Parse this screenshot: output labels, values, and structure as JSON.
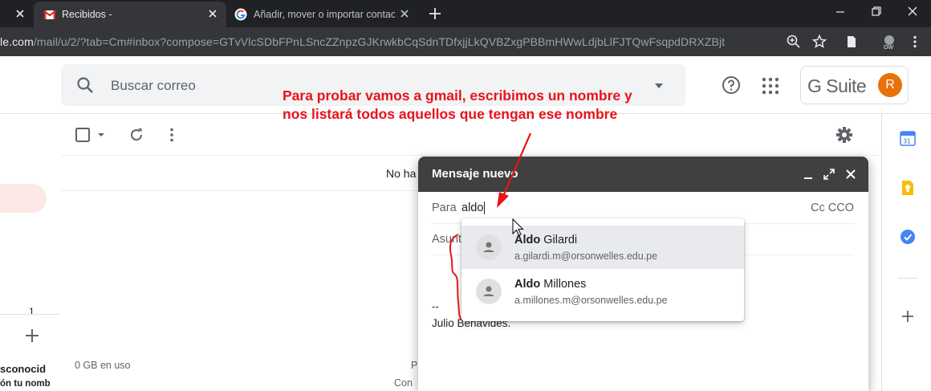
{
  "browser": {
    "tabs": [
      {
        "title": "Recibidos -",
        "active": true,
        "icon": "gmail-icon"
      },
      {
        "title": "Añadir, mover o importar contact",
        "active": false,
        "icon": "google-g-icon"
      }
    ],
    "url_domain": "le.com",
    "url_path": "/mail/u/2/?tab=Cm#inbox?compose=GTvVlcSDbFPnLSncZZnpzGJKrwkbCqSdnTDfxjjLkQVBZxgPBBmHWwLdjbLlFJTQwFsqpdDRXZBjt"
  },
  "gmail": {
    "search_placeholder": "Buscar correo",
    "gsuite_label": "G Suite",
    "avatar_initial": "R",
    "no_messages_partial": "No ha",
    "storage": "0 GB en uso",
    "footer_p": "P",
    "footer_con": "Con",
    "sidebar": {
      "count": "1",
      "unknown_name": "sconocid",
      "unknown_sub": "ón tu nomb"
    }
  },
  "compose": {
    "title": "Mensaje nuevo",
    "to_label": "Para",
    "to_value": "aldo",
    "cc_label": "Cc CCO",
    "subject_placeholder": "Asunto",
    "signature_dash": "--",
    "signature_name": "Julio Benavides."
  },
  "autocomplete": [
    {
      "bold": "Aldo",
      "rest": " Gilardi",
      "email": "a.gilardi.m@orsonwelles.edu.pe",
      "highlighted": true
    },
    {
      "bold": "Aldo",
      "rest": " Millones",
      "email": "a.millones.m@orsonwelles.edu.pe",
      "highlighted": false
    }
  ],
  "annotation": {
    "line1": "Para probar vamos a gmail, escribimos un nombre y",
    "line2": "nos listará todos aquellos que tengan ese nombre",
    "color": "#e8141b"
  },
  "colors": {
    "chrome_dark": "#202124",
    "chrome_tab": "#35363a",
    "compose_header": "#404040",
    "avatar": "#e8710a",
    "inbox_pill": "#fce8e6"
  }
}
